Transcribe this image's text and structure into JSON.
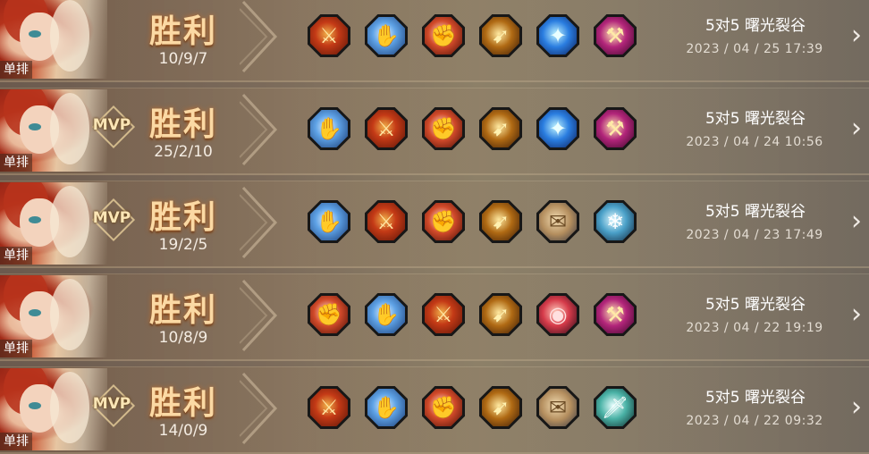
{
  "colors": {
    "win_text": "#fbd9a4",
    "win_glow": "#c86e28",
    "mvp_text": "#fbe6b6"
  },
  "matches": [
    {
      "mode_tag": "单排",
      "mvp": "",
      "result": "胜利",
      "kda": "10/9/7",
      "items": [
        "red-axe-icon",
        "blue-claw-icon",
        "crit-orb-icon",
        "golden-spear-icon",
        "cyan-staff-icon",
        "purple-hammer-icon"
      ],
      "map": "5对5 曙光裂谷",
      "date": "2023 / 04 / 25  17:39"
    },
    {
      "mode_tag": "单排",
      "mvp": "MVP",
      "result": "胜利",
      "kda": "25/2/10",
      "items": [
        "blue-claw-icon",
        "red-axe-icon",
        "crit-orb-icon",
        "golden-spear-icon",
        "cyan-staff-icon",
        "purple-hammer-icon"
      ],
      "map": "5对5 曙光裂谷",
      "date": "2023 / 04 / 24  10:56"
    },
    {
      "mode_tag": "单排",
      "mvp": "MVP",
      "result": "胜利",
      "kda": "19/2/5",
      "items": [
        "blue-claw-icon",
        "red-axe-icon",
        "crit-orb-icon",
        "golden-spear-icon",
        "scroll-icon",
        "ice-wing-icon"
      ],
      "map": "5对5 曙光裂谷",
      "date": "2023 / 04 / 23  17:49"
    },
    {
      "mode_tag": "单排",
      "mvp": "",
      "result": "胜利",
      "kda": "10/8/9",
      "items": [
        "crit-orb-icon",
        "blue-claw-icon",
        "red-axe-icon",
        "golden-spear-icon",
        "red-ring-icon",
        "purple-hammer-icon"
      ],
      "map": "5对5 曙光裂谷",
      "date": "2023 / 04 / 22  19:19"
    },
    {
      "mode_tag": "单排",
      "mvp": "MVP",
      "result": "胜利",
      "kda": "14/0/9",
      "items": [
        "red-axe-icon",
        "blue-claw-icon",
        "crit-orb-icon",
        "golden-spear-icon",
        "scroll-icon",
        "jade-sword-icon"
      ],
      "map": "5对5 曙光裂谷",
      "date": "2023 / 04 / 22  09:32"
    }
  ]
}
